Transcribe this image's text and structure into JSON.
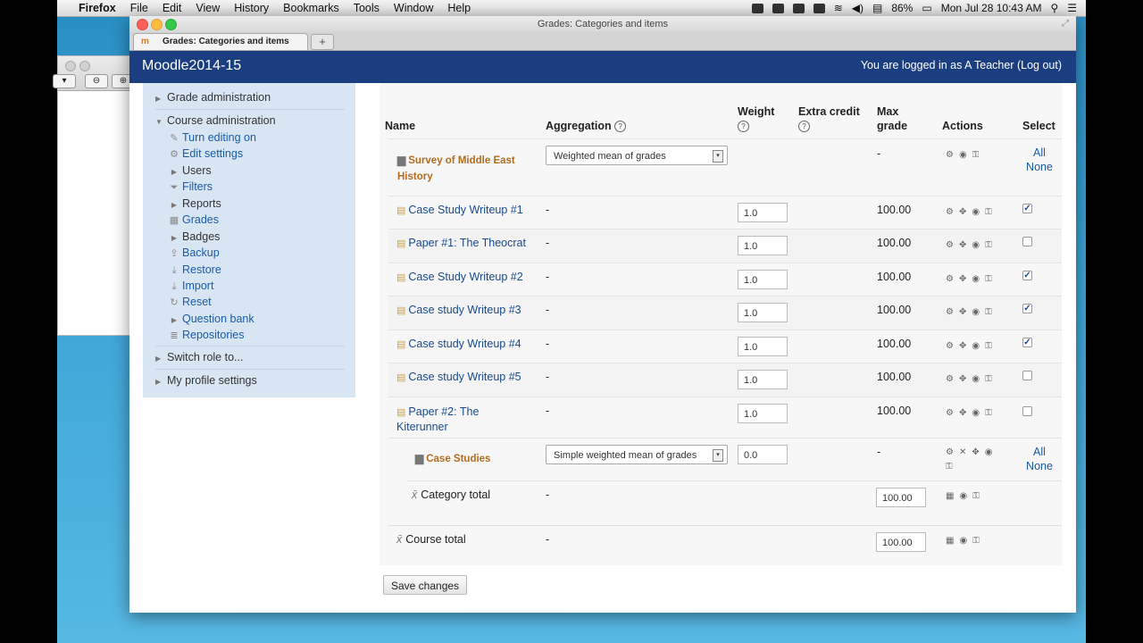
{
  "menubar": {
    "app": "Firefox",
    "items": [
      "File",
      "Edit",
      "View",
      "History",
      "Bookmarks",
      "Tools",
      "Window",
      "Help"
    ],
    "battery": "86%",
    "datetime": "Mon Jul 28  10:43 AM"
  },
  "window": {
    "title": "Grades: Categories and items",
    "tab_label": "Grades: Categories and items",
    "new_tab": "+"
  },
  "site": {
    "name": "Moodle2014-15",
    "login_text": "You are logged in as A Teacher (Log out)"
  },
  "sidebar": {
    "grade_admin": "Grade administration",
    "course_admin": "Course administration",
    "items": [
      {
        "label": "Turn editing on",
        "icon": "pencil-icon"
      },
      {
        "label": "Edit settings",
        "icon": "gear-icon"
      },
      {
        "label": "Users",
        "icon": "triangle-icon"
      },
      {
        "label": "Filters",
        "icon": "filter-icon"
      },
      {
        "label": "Reports",
        "icon": "triangle-icon"
      },
      {
        "label": "Grades",
        "icon": "grades-icon"
      },
      {
        "label": "Badges",
        "icon": "triangle-icon"
      },
      {
        "label": "Backup",
        "icon": "backup-icon"
      },
      {
        "label": "Restore",
        "icon": "restore-icon"
      },
      {
        "label": "Import",
        "icon": "import-icon"
      },
      {
        "label": "Reset",
        "icon": "reset-icon"
      },
      {
        "label": "Question bank",
        "icon": "triangle-icon"
      },
      {
        "label": "Repositories",
        "icon": "repository-icon"
      }
    ],
    "switch_role": "Switch role to...",
    "profile_settings": "My profile settings"
  },
  "table": {
    "headers": {
      "name": "Name",
      "aggregation": "Aggregation",
      "weight": "Weight",
      "extra_credit": "Extra credit",
      "max_grade_1": "Max",
      "max_grade_2": "grade",
      "actions": "Actions",
      "select": "Select"
    },
    "category": {
      "name_1": "Survey of Middle East",
      "name_2": "History",
      "aggregation": "Weighted mean of grades",
      "max_grade": "-",
      "all": "All",
      "none": "None"
    },
    "items": [
      {
        "name": "Case Study Writeup #1",
        "agg": "-",
        "weight": "1.0",
        "max": "100.00",
        "checked": true
      },
      {
        "name": "Paper #1: The Theocrat",
        "agg": "-",
        "weight": "1.0",
        "max": "100.00",
        "checked": false
      },
      {
        "name": "Case Study Writeup #2",
        "agg": "-",
        "weight": "1.0",
        "max": "100.00",
        "checked": true
      },
      {
        "name": "Case study Writeup #3",
        "agg": "-",
        "weight": "1.0",
        "max": "100.00",
        "checked": true
      },
      {
        "name": "Case study Writeup #4",
        "agg": "-",
        "weight": "1.0",
        "max": "100.00",
        "checked": true
      },
      {
        "name": "Case study Writeup #5",
        "agg": "-",
        "weight": "1.0",
        "max": "100.00",
        "checked": false
      }
    ],
    "item7": {
      "name_1": "Paper #2: The",
      "name_2": "Kiterunner",
      "agg": "-",
      "weight": "1.0",
      "max": "100.00",
      "checked": false
    },
    "subcategory": {
      "name": "Case Studies",
      "aggregation": "Simple weighted mean of grades",
      "weight": "0.0",
      "max_grade": "-",
      "all": "All",
      "none": "None"
    },
    "category_total": {
      "name": "Category total",
      "agg": "-",
      "max": "100.00"
    },
    "course_total": {
      "name": "Course total",
      "agg": "-",
      "max": "100.00"
    }
  },
  "save_button": "Save changes"
}
